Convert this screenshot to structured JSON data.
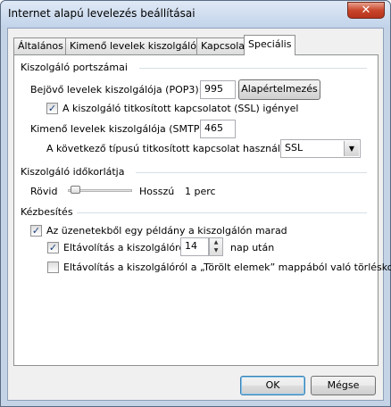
{
  "window": {
    "title": "Internet alapú levelezés beállításai",
    "close_glyph": "✕"
  },
  "tabs": [
    {
      "label": "Általános",
      "active": false
    },
    {
      "label": "Kimenő levelek kiszolgálója",
      "active": false
    },
    {
      "label": "Kapcsolat",
      "active": false
    },
    {
      "label": "Speciális",
      "active": true
    }
  ],
  "ports": {
    "section": "Kiszolgáló portszámai",
    "pop3_label": "Bejövő levelek kiszolgálója (POP3):",
    "pop3_value": "995",
    "defaults_button": "Alapértelmezés",
    "ssl_label": "A kiszolgáló titkosított kapcsolatot (SSL) igényel",
    "ssl_checked": true,
    "smtp_label": "Kimenő levelek kiszolgálója (SMTP):",
    "smtp_value": "465",
    "enc_label": "A következő típusú titkosított kapcsolat használata:",
    "enc_value": "SSL"
  },
  "timeout": {
    "section": "Kiszolgáló időkorlátja",
    "short_label": "Rövid",
    "long_label": "Hosszú",
    "value_text": "1 perc",
    "level_fraction": 0.05
  },
  "delivery": {
    "section": "Kézbesítés",
    "leave_copy_label": "Az üzenetekből egy példány a kiszolgálón marad",
    "leave_copy_checked": true,
    "remove_after_label": "Eltávolítás a kiszolgálóról",
    "remove_after_checked": true,
    "remove_after_value": "14",
    "remove_after_unit": "nap után",
    "remove_deleted_label": "Eltávolítás a kiszolgálóról a „Törölt elemek” mappából való törléskor",
    "remove_deleted_checked": false
  },
  "footer": {
    "ok": "OK",
    "cancel": "Mégse"
  }
}
